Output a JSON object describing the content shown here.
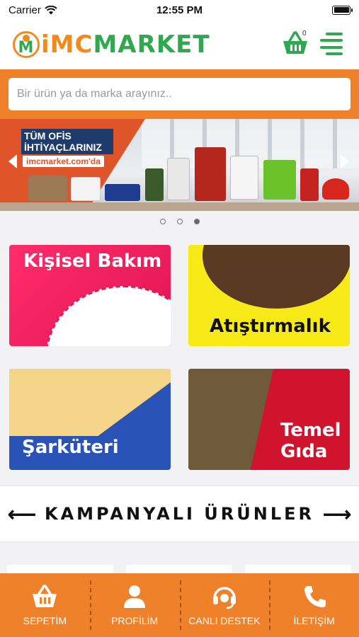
{
  "status_bar": {
    "carrier": "Carrier",
    "time": "12:55 PM"
  },
  "header": {
    "logo_first": "iMC",
    "logo_second": "MARKET",
    "cart_count": "0"
  },
  "search": {
    "placeholder": "Bir ürün ya da marka arayınız.."
  },
  "banner": {
    "title": "TÜM OFİS İHTİYAÇLARINIZ",
    "url": "imcmarket.com'da",
    "slide_count": 3,
    "active_slide": 3
  },
  "categories": [
    {
      "label": "Kişisel Bakım"
    },
    {
      "label": "Atıştırmalık"
    },
    {
      "label": "Şarküteri"
    },
    {
      "label": "Temel Gıda"
    }
  ],
  "campaign": {
    "label": "KAMPANYALI ÜRÜNLER"
  },
  "bottom_nav": [
    {
      "label": "SEPETİM",
      "icon": "basket-icon"
    },
    {
      "label": "PROFİLİM",
      "icon": "user-icon"
    },
    {
      "label": "CANLI DESTEK",
      "icon": "headset-icon"
    },
    {
      "label": "İLETİŞİM",
      "icon": "phone-icon"
    }
  ],
  "colors": {
    "brand_orange": "#f0812b",
    "brand_green": "#2fa84f"
  }
}
